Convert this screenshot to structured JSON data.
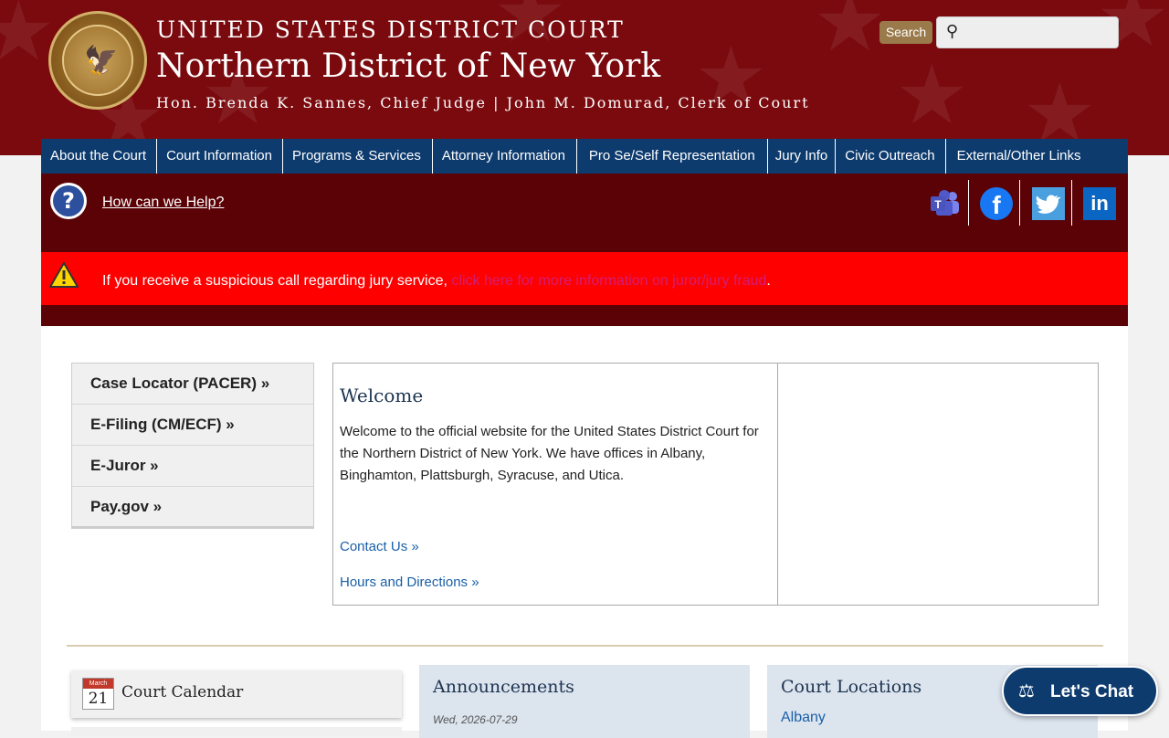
{
  "header": {
    "line1": "UNITED STATES DISTRICT COURT",
    "line2": "Northern District of New York",
    "line3": "Hon. Brenda K. Sannes, Chief Judge | John M. Domurad, Clerk of Court",
    "search_label": "Search",
    "search_placeholder": ""
  },
  "nav": {
    "items": [
      "About the Court",
      "Court Information",
      "Programs & Services",
      "Attorney Information",
      "Pro Se/Self Representation",
      "Jury Info",
      "Civic Outreach",
      "External/Other Links"
    ]
  },
  "helpbar": {
    "help_text": "How can we Help?",
    "social": [
      "teams-icon",
      "facebook-icon",
      "twitter-icon",
      "linkedin-icon"
    ]
  },
  "alert": {
    "text": "If you receive a suspicious call regarding jury service, ",
    "link_text": "click here for more information on juror/jury fraud",
    "end": "."
  },
  "quick_links": [
    "Case Locator (PACER) »",
    "E-Filing (CM/ECF) »",
    "E-Juror »",
    "Pay.gov »"
  ],
  "welcome": {
    "title": "Welcome",
    "body": "Welcome to the official website for the United States District Court for the Northern District of New York. We have offices in Albany, Binghamton, Plattsburgh, Syracuse, and Utica.",
    "contact_link": "Contact Us »",
    "hours_link": "Hours and Directions »"
  },
  "calendar": {
    "month": "March",
    "day": "21",
    "title": "Court Calendar"
  },
  "announcements": {
    "title": "Announcements",
    "date": "Wed, 2026-07-29"
  },
  "locations": {
    "title": "Court Locations",
    "first": "Albany"
  },
  "chat": {
    "label": "Let's Chat"
  },
  "colors": {
    "header_bg": "#7a0a0e",
    "nav_bg": "#0d3b6e",
    "helpbar_bg": "#5a0206",
    "alert_bg": "#ff0000",
    "link": "#1a5fa8"
  }
}
